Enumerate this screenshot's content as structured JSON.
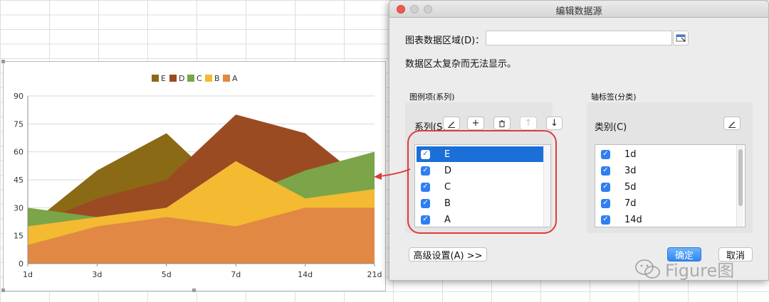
{
  "dialog": {
    "title": "编辑数据源",
    "range_label": "图表数据区域(D)：",
    "range_value": "",
    "message": "数据区太复杂而无法显示。",
    "legend_panel": {
      "heading": "图例项(系列)",
      "label": "系列(S)",
      "tools": [
        "edit-icon",
        "plus-icon",
        "trash-icon",
        "arrow-up-icon",
        "arrow-down-icon"
      ],
      "items": [
        {
          "label": "E",
          "checked": true,
          "selected": true
        },
        {
          "label": "D",
          "checked": true,
          "selected": false
        },
        {
          "label": "C",
          "checked": true,
          "selected": false
        },
        {
          "label": "B",
          "checked": true,
          "selected": false
        },
        {
          "label": "A",
          "checked": true,
          "selected": false
        }
      ]
    },
    "axis_panel": {
      "heading": "轴标签(分类)",
      "label": "类别(C)",
      "items": [
        {
          "label": "1d",
          "checked": true
        },
        {
          "label": "3d",
          "checked": true
        },
        {
          "label": "5d",
          "checked": true
        },
        {
          "label": "7d",
          "checked": true
        },
        {
          "label": "14d",
          "checked": true
        }
      ]
    },
    "advanced_button": "高级设置(A) >>",
    "ok_button": "确定",
    "cancel_button": "取消"
  },
  "watermark": {
    "text": "Figure图"
  },
  "colors": {
    "accent": "#2f7ff0",
    "annotation": "#e03a3a"
  },
  "chart_data": {
    "type": "area",
    "stacked": false,
    "categories": [
      "1d",
      "3d",
      "5d",
      "7d",
      "14d",
      "21d"
    ],
    "ylim": [
      0,
      90
    ],
    "yticks": [
      0,
      15,
      30,
      45,
      60,
      75,
      90
    ],
    "legend_position": "top",
    "legend": [
      "E",
      "D",
      "C",
      "B",
      "A"
    ],
    "series": [
      {
        "name": "E",
        "color": "#8b6a16",
        "values": [
          20,
          50,
          70,
          35,
          35,
          35
        ]
      },
      {
        "name": "D",
        "color": "#9b4b22",
        "values": [
          20,
          35,
          45,
          80,
          70,
          40
        ]
      },
      {
        "name": "C",
        "color": "#7ba548",
        "values": [
          30,
          25,
          30,
          35,
          50,
          60
        ]
      },
      {
        "name": "B",
        "color": "#f3ba32",
        "values": [
          20,
          25,
          30,
          55,
          35,
          40
        ]
      },
      {
        "name": "A",
        "color": "#e08844",
        "values": [
          10,
          20,
          25,
          20,
          30,
          30
        ]
      }
    ]
  }
}
